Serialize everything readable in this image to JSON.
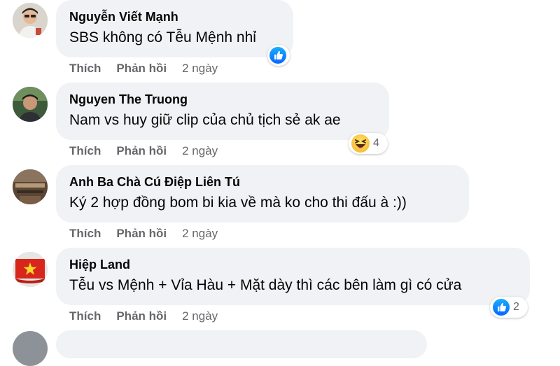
{
  "colors": {
    "bubble": "#f0f2f5",
    "name": "#050505",
    "meta": "#65676b",
    "like": "#0866ff",
    "haha": "#f7b125"
  },
  "comments": [
    {
      "author": "Nguyễn Viết Mạnh",
      "text": "SBS không có Tễu Mệnh nhỉ",
      "like_label": "Thích",
      "reply_label": "Phản hồi",
      "time": "2 ngày",
      "reaction": {
        "icon": "like-icon",
        "count": ""
      }
    },
    {
      "author": "Nguyen The Truong",
      "text": "Nam vs huy giữ clip của chủ tịch sẻ ak ae",
      "like_label": "Thích",
      "reply_label": "Phản hồi",
      "time": "2 ngày",
      "reaction": {
        "icon": "haha-icon",
        "count": "4"
      }
    },
    {
      "author": "Anh Ba Chà Cú Điệp Liên Tú",
      "text": "Ký 2 hợp đồng bom bi kia về mà ko cho thi đấu à :))",
      "like_label": "Thích",
      "reply_label": "Phản hồi",
      "time": "2 ngày"
    },
    {
      "author": "Hiệp Land",
      "text": "Tễu vs Mệnh + Vỉa Hàu + Mặt dày thì các bên làm gì có cửa",
      "like_label": "Thích",
      "reply_label": "Phản hồi",
      "time": "2 ngày",
      "reaction": {
        "icon": "like-icon",
        "count": "2"
      }
    }
  ]
}
